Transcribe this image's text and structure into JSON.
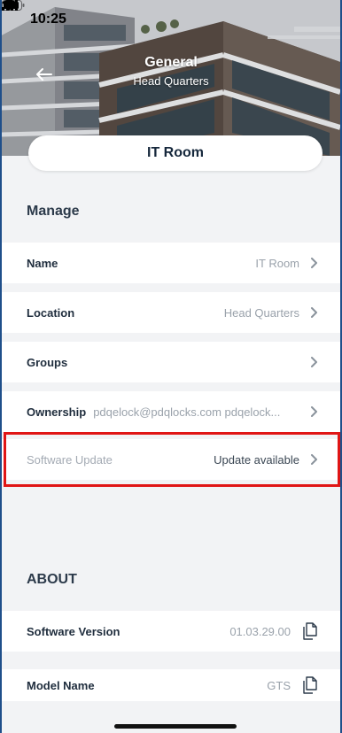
{
  "status_bar": {
    "time": "10:25",
    "icons": [
      "cellular-signal-icon",
      "wifi-icon",
      "battery-icon"
    ]
  },
  "header": {
    "title": "General",
    "subtitle": "Head Quarters",
    "device_name": "IT Room",
    "back_icon": "back-arrow-icon"
  },
  "manage": {
    "heading": "Manage",
    "rows": [
      {
        "label": "Name",
        "value": "IT Room"
      },
      {
        "label": "Location",
        "value": "Head Quarters"
      },
      {
        "label": "Groups",
        "value": ""
      },
      {
        "label": "Ownership",
        "value": "pdqelock@pdqlocks.com pdqelock..."
      },
      {
        "label": "Software Update",
        "value": "Update available"
      }
    ]
  },
  "about": {
    "heading": "ABOUT",
    "rows": [
      {
        "label": "Software Version",
        "value": "01.03.29.00"
      },
      {
        "label": "Model Name",
        "value": "GTS"
      }
    ]
  },
  "colors": {
    "highlight": "#e01515",
    "frame": "#1f4f8a",
    "background": "#f2f3f5"
  }
}
